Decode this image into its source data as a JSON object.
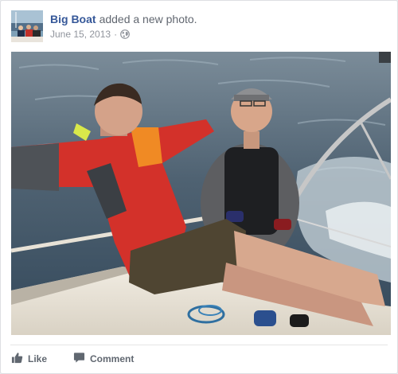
{
  "post": {
    "author": "Big Boat",
    "action": "added a new photo.",
    "date": "June 15, 2013",
    "separator": "·",
    "privacy_icon": "globe-icon",
    "photo_icon": "photo"
  },
  "actions": {
    "like_label": "Like",
    "like_icon": "thumbs-up-icon",
    "comment_label": "Comment",
    "comment_icon": "comment-bubble-icon"
  },
  "colors": {
    "link": "#365899",
    "secondary_text": "#90949c",
    "action_text": "#606770"
  }
}
